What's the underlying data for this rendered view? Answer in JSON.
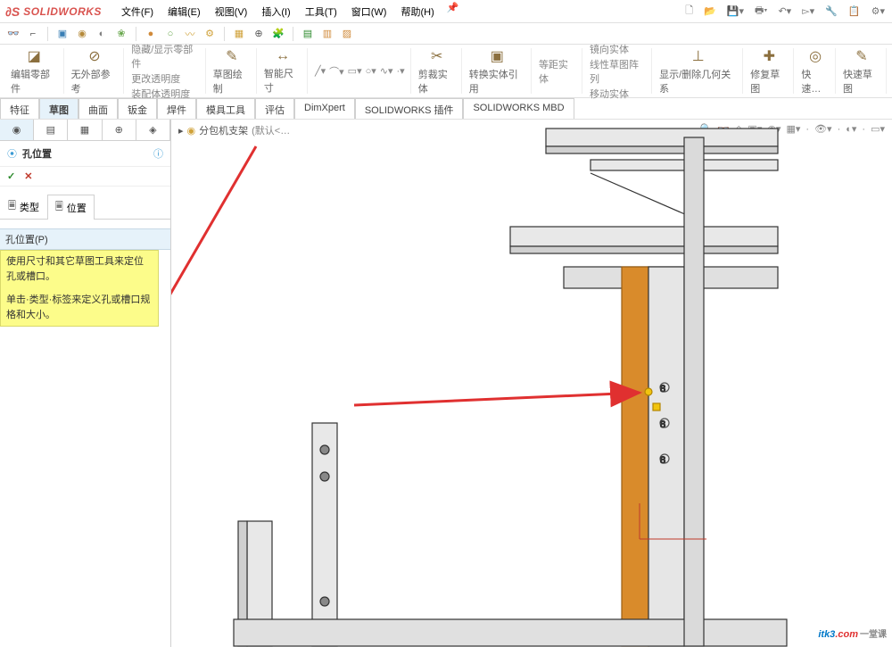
{
  "app": {
    "logo_text": "SOLIDWORKS"
  },
  "menubar": [
    "文件(F)",
    "编辑(E)",
    "视图(V)",
    "插入(I)",
    "工具(T)",
    "窗口(W)",
    "帮助(H)"
  ],
  "ribbon": {
    "edit_part": "编辑零部件",
    "no_ext_ref": "无外部参考",
    "mode_stack": [
      "隐藏/显示零部件",
      "更改透明度",
      "装配体透明度"
    ],
    "sketch": "草图绘制",
    "smart_dim": "智能尺寸",
    "trim": "剪裁实体",
    "convert": "转换实体引用",
    "wait": "等距实体",
    "mirror_stack": [
      "镜向实体",
      "线性草图阵列",
      "移动实体"
    ],
    "relations": "显示/删除几何关系",
    "repair": "修复草图",
    "rapid": "快速…",
    "quick_sketch": "快速草图"
  },
  "command_tabs": [
    "特征",
    "草图",
    "曲面",
    "钣金",
    "焊件",
    "模具工具",
    "评估",
    "DimXpert",
    "SOLIDWORKS 插件",
    "SOLIDWORKS MBD"
  ],
  "feature_mgr": {
    "title": "孔位置",
    "sub_tabs": {
      "type": "类型",
      "position": "位置"
    },
    "section": "孔位置(P)",
    "help_text_1": "使用尺寸和其它草图工具来定位孔或槽口。",
    "help_text_2": "单击·类型·标签来定义孔或槽口规格和大小。"
  },
  "breadcrumb": {
    "item": "分包机支架",
    "suffix": "(默认<…"
  },
  "watermark": {
    "main": "itk3",
    "dot": ".com",
    "tag": "一堂课"
  }
}
